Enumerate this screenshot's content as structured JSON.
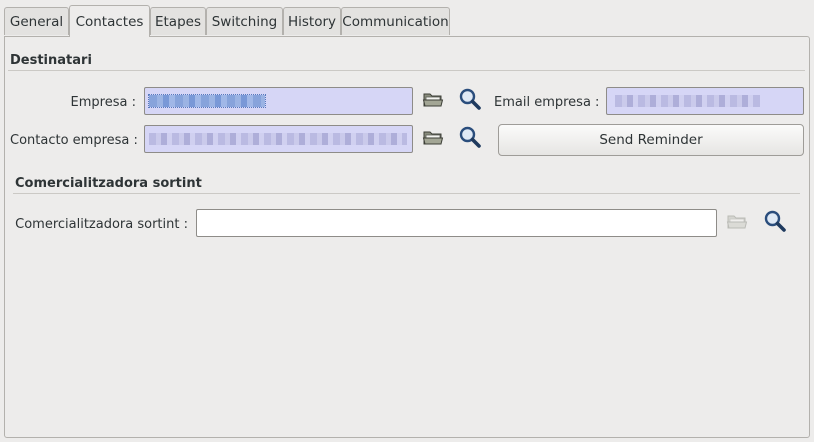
{
  "tabs": [
    {
      "label": "General"
    },
    {
      "label": "Contactes"
    },
    {
      "label": "Etapes"
    },
    {
      "label": "Switching"
    },
    {
      "label": "History"
    },
    {
      "label": "Communication"
    }
  ],
  "active_tab": "Contactes",
  "destinatari": {
    "title": "Destinatari",
    "empresa_label": "Empresa :",
    "contacto_label": "Contacto empresa :",
    "email_label": "Email empresa :",
    "send_reminder_label": "Send Reminder"
  },
  "comercialitzadora": {
    "title": "Comercialitzadora sortint",
    "field_label": "Comercialitzadora sortint :",
    "value": ""
  },
  "icons": {
    "open": "folder-open-icon",
    "search": "search-icon"
  },
  "colors": {
    "required_field_bg": "#d6d6f6",
    "selection": "#7f9ed9"
  }
}
